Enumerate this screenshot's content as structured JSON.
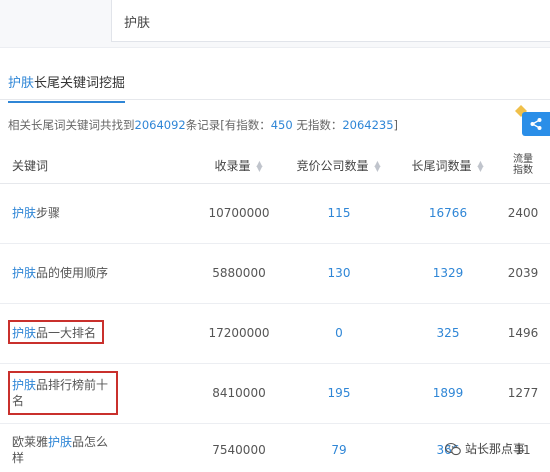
{
  "search": {
    "value": "护肤"
  },
  "tab": {
    "label_kw": "护肤",
    "label_rest": "长尾关键词挖掘"
  },
  "summary": {
    "prefix": "相关长尾词关键词共找到",
    "total": "2064092",
    "mid1": "条记录[有指数：",
    "indexed": "450",
    "mid2": "  无指数：",
    "unindexed": "2064235",
    "suffix": "]"
  },
  "table": {
    "headers": {
      "keyword": "关键词",
      "indexed": "收录量",
      "bidding": "竞价公司数量",
      "longtail": "长尾词数量",
      "traffic_line1": "流量",
      "traffic_line2": "指数"
    },
    "rows": [
      {
        "kw": "护肤",
        "rest": "步骤",
        "indexed": "10700000",
        "bidding": "115",
        "longtail": "16766",
        "traffic": "2400"
      },
      {
        "kw": "护肤",
        "rest": "品的使用顺序",
        "indexed": "5880000",
        "bidding": "130",
        "longtail": "1329",
        "traffic": "2039"
      },
      {
        "kw": "护肤",
        "rest": "品一大排名",
        "indexed": "17200000",
        "bidding": "0",
        "longtail": "325",
        "traffic": "1496"
      },
      {
        "kw": "护肤",
        "rest": "品排行榜前十名",
        "indexed": "8410000",
        "bidding": "195",
        "longtail": "1899",
        "traffic": "1277"
      },
      {
        "pre": "欧莱雅",
        "kw": "护肤",
        "rest": "品怎么样",
        "indexed": "7540000",
        "bidding": "79",
        "longtail": "366",
        "traffic": "11"
      }
    ]
  },
  "watermark": {
    "text": "站长那点事"
  },
  "colors": {
    "accent": "#2f86d6",
    "highlight": "#c9302c",
    "share": "#2a8ee8"
  }
}
